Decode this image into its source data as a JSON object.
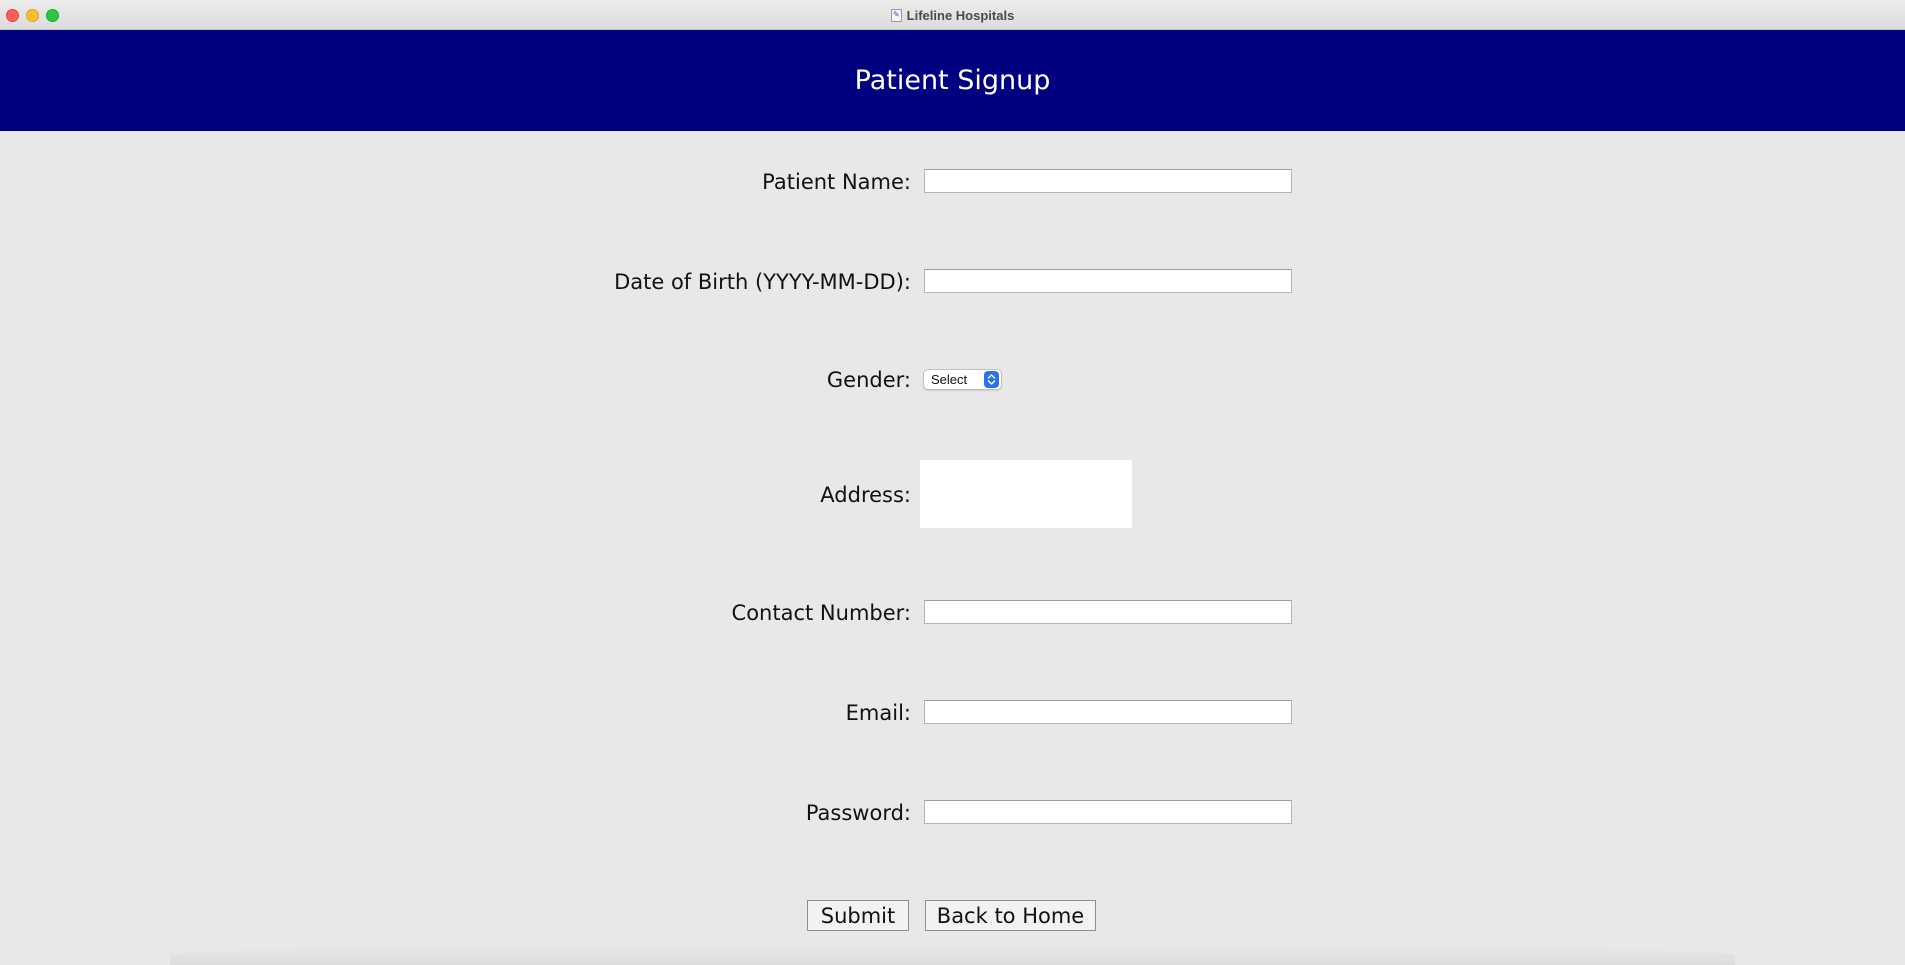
{
  "window": {
    "title": "Lifeline Hospitals",
    "app_icon": "feather-icon"
  },
  "header": {
    "title": "Patient Signup",
    "background_color": "#000080"
  },
  "form": {
    "patient_name": {
      "label": "Patient Name:",
      "value": ""
    },
    "dob": {
      "label": "Date of Birth (YYYY-MM-DD):",
      "value": ""
    },
    "gender": {
      "label": "Gender:",
      "selected": "Select"
    },
    "address": {
      "label": "Address:",
      "value": ""
    },
    "contact_number": {
      "label": "Contact Number:",
      "value": ""
    },
    "email": {
      "label": "Email:",
      "value": ""
    },
    "password": {
      "label": "Password:",
      "value": ""
    }
  },
  "buttons": {
    "submit": "Submit",
    "back_home": "Back to Home"
  }
}
